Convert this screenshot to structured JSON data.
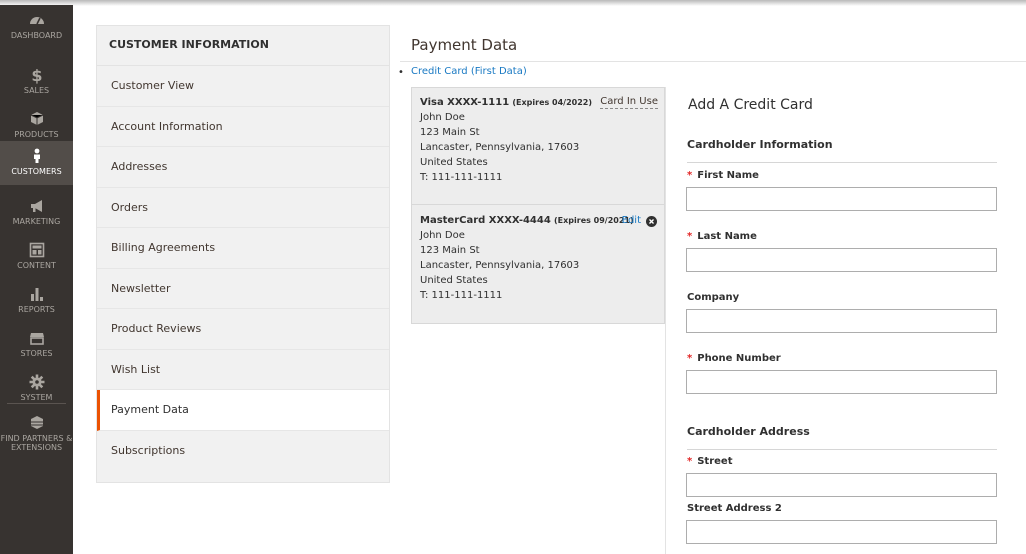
{
  "nav": {
    "items": [
      {
        "label": "DASHBOARD",
        "icon": "dashboard-icon"
      },
      {
        "label": "SALES",
        "icon": "dollar-icon"
      },
      {
        "label": "PRODUCTS",
        "icon": "cube-icon"
      },
      {
        "label": "CUSTOMERS",
        "icon": "person-icon",
        "active": true
      },
      {
        "label": "MARKETING",
        "icon": "megaphone-icon"
      },
      {
        "label": "CONTENT",
        "icon": "layout-icon"
      },
      {
        "label": "REPORTS",
        "icon": "bar-chart-icon"
      },
      {
        "label": "STORES",
        "icon": "store-icon"
      },
      {
        "label": "SYSTEM",
        "icon": "gear-icon"
      },
      {
        "label": "FIND PARTNERS & EXTENSIONS",
        "icon": "partners-icon"
      }
    ]
  },
  "customer_info": {
    "title": "CUSTOMER INFORMATION",
    "tabs": [
      "Customer View",
      "Account Information",
      "Addresses",
      "Orders",
      "Billing Agreements",
      "Newsletter",
      "Product Reviews",
      "Wish List",
      "Payment Data",
      "Subscriptions"
    ],
    "active_tab": "Payment Data"
  },
  "payment": {
    "title": "Payment Data",
    "method_link": "Credit Card (First Data)",
    "cards": [
      {
        "name": "Visa XXXX-1111",
        "expires": "(Expires 04/2022)",
        "holder": "John Doe",
        "street": "123 Main St",
        "city_line": "Lancaster, Pennsylvania, 17603",
        "country": "United States",
        "phone": "T: 111-111-1111",
        "status": "Card In Use"
      },
      {
        "name": "MasterCard XXXX-4444",
        "expires": "(Expires 09/2021)",
        "holder": "John Doe",
        "street": "123 Main St",
        "city_line": "Lancaster, Pennsylvania, 17603",
        "country": "United States",
        "phone": "T: 111-111-1111",
        "edit_label": "Edit"
      }
    ]
  },
  "form": {
    "title": "Add A Credit Card",
    "cardholder_info": "Cardholder Information",
    "cardholder_address": "Cardholder Address",
    "required_mark": "*",
    "fields": {
      "first_name": {
        "label": "First Name",
        "value": ""
      },
      "last_name": {
        "label": "Last Name",
        "value": ""
      },
      "company": {
        "label": "Company",
        "value": ""
      },
      "phone": {
        "label": "Phone Number",
        "value": ""
      },
      "street": {
        "label": "Street",
        "value": ""
      },
      "street2": {
        "label": "Street Address 2",
        "value": ""
      }
    }
  },
  "colors": {
    "nav_bg": "#373330",
    "accent": "#eb5202",
    "link": "#1979c3",
    "required": "#e22626"
  }
}
